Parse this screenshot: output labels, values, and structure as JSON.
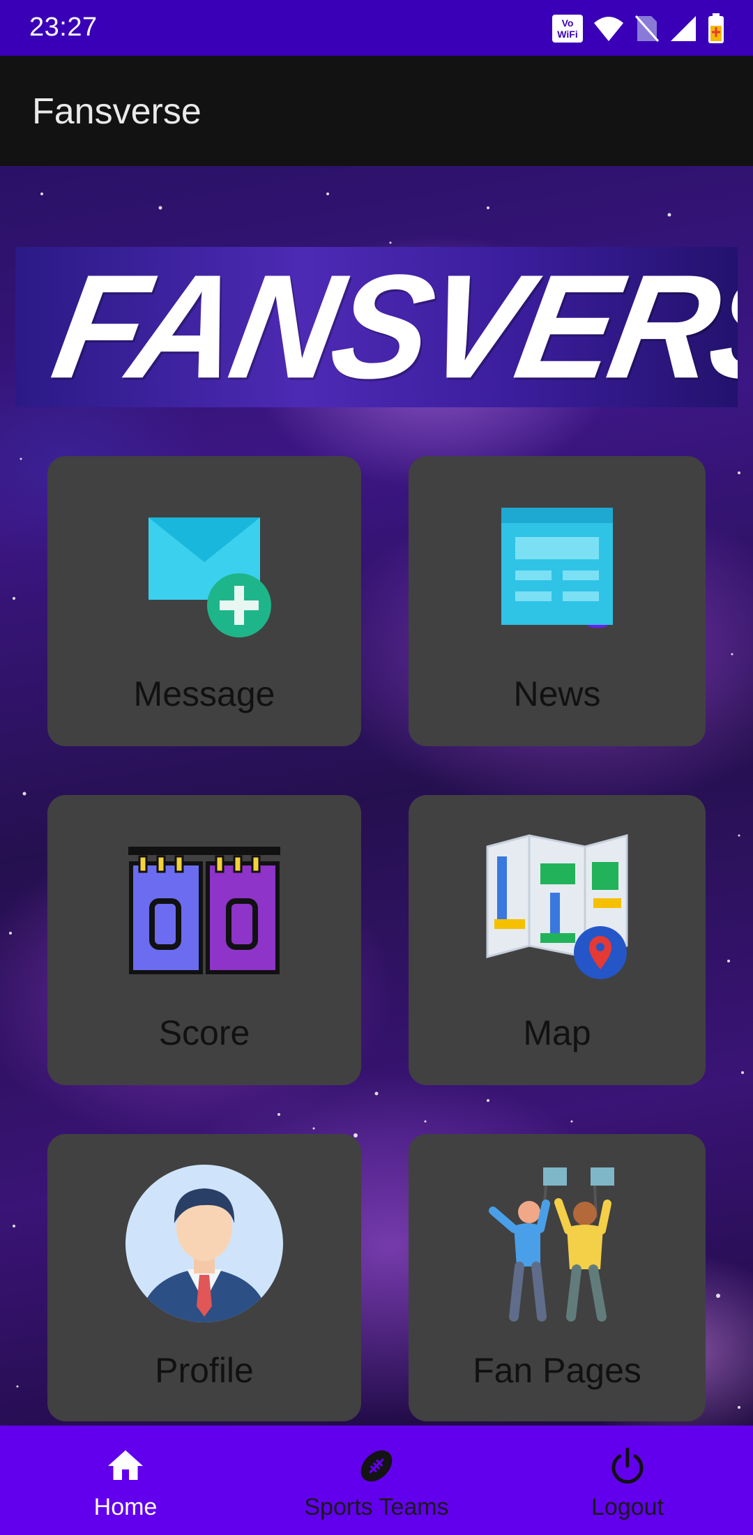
{
  "status_bar": {
    "time": "23:27",
    "vowifi_line1": "Vo",
    "vowifi_line2": "WiFi",
    "icons": [
      "vowifi-icon",
      "wifi-icon",
      "no-sim-icon",
      "signal-icon",
      "battery-charging-icon"
    ]
  },
  "app_bar": {
    "title": "Fansverse"
  },
  "banner": {
    "text": "FANSVERSE"
  },
  "tiles": [
    {
      "label": "Message",
      "icon": "mail-add-icon"
    },
    {
      "label": "News",
      "icon": "newspaper-icon"
    },
    {
      "label": "Score",
      "icon": "scoreboard-icon"
    },
    {
      "label": "Map",
      "icon": "map-pin-icon"
    },
    {
      "label": "Profile",
      "icon": "profile-avatar-icon"
    },
    {
      "label": "Fan Pages",
      "icon": "fans-cheering-icon"
    }
  ],
  "bottom_nav": {
    "items": [
      {
        "label": "Home",
        "icon": "home-icon",
        "active": true
      },
      {
        "label": "Sports Teams",
        "icon": "football-icon",
        "active": false
      },
      {
        "label": "Logout",
        "icon": "power-icon",
        "active": false
      }
    ]
  },
  "colors": {
    "status_bar": "#3a00b8",
    "app_bar": "#121212",
    "tile": "#414141",
    "bottom_nav": "#6200ee",
    "nav_active": "#ffffff",
    "nav_inactive": "#1a1a1a"
  }
}
